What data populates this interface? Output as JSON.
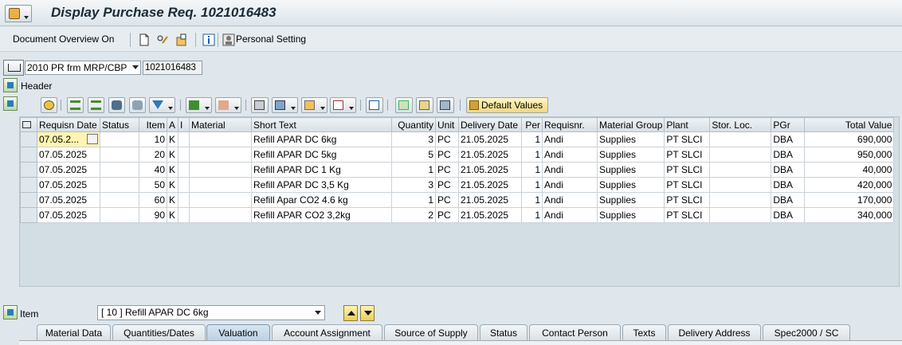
{
  "window": {
    "title": "Display Purchase Req. 1021016483"
  },
  "app_toolbar": {
    "doc_overview_label": "Document Overview On",
    "personal_setting_label": "Personal Setting"
  },
  "doc_header": {
    "doc_type": "2010 PR frm MRP/CBP",
    "doc_number": "1021016483",
    "header_label": "Header"
  },
  "grid_toolbar": {
    "default_values_label": "Default Values"
  },
  "table": {
    "columns": [
      "Requisn Date",
      "Status",
      "Item",
      "A",
      "I",
      "Material",
      "Short Text",
      "Quantity",
      "Unit",
      "Delivery Date",
      "Per",
      "Requisnr.",
      "Material Group",
      "Plant",
      "Stor. Loc.",
      "PGr",
      "Total Value"
    ],
    "rows": [
      [
        "07.05.2...",
        "",
        "10",
        "K",
        "",
        "",
        "Refill APAR DC 6kg",
        "3",
        "PC",
        "21.05.2025",
        "1",
        "Andi",
        "Supplies",
        "PT SLCI",
        "",
        "DBA",
        "690,000"
      ],
      [
        "07.05.2025",
        "",
        "20",
        "K",
        "",
        "",
        "Refill APAR DC 5kg",
        "5",
        "PC",
        "21.05.2025",
        "1",
        "Andi",
        "Supplies",
        "PT SLCI",
        "",
        "DBA",
        "950,000"
      ],
      [
        "07.05.2025",
        "",
        "40",
        "K",
        "",
        "",
        "Refill APAR DC 1 Kg",
        "1",
        "PC",
        "21.05.2025",
        "1",
        "Andi",
        "Supplies",
        "PT SLCI",
        "",
        "DBA",
        "40,000"
      ],
      [
        "07.05.2025",
        "",
        "50",
        "K",
        "",
        "",
        "Refill APAR DC 3,5 Kg",
        "3",
        "PC",
        "21.05.2025",
        "1",
        "Andi",
        "Supplies",
        "PT SLCI",
        "",
        "DBA",
        "420,000"
      ],
      [
        "07.05.2025",
        "",
        "60",
        "K",
        "",
        "",
        "Refill Apar CO2 4.6 kg",
        "1",
        "PC",
        "21.05.2025",
        "1",
        "Andi",
        "Supplies",
        "PT SLCI",
        "",
        "DBA",
        "170,000"
      ],
      [
        "07.05.2025",
        "",
        "90",
        "K",
        "",
        "",
        "Refill APAR CO2 3,2kg",
        "2",
        "PC",
        "21.05.2025",
        "1",
        "Andi",
        "Supplies",
        "PT SLCI",
        "",
        "DBA",
        "340,000"
      ]
    ]
  },
  "item": {
    "label": "Item",
    "selected": "[ 10 ] Refill APAR DC 6kg"
  },
  "tabs": [
    {
      "label": "Material Data"
    },
    {
      "label": "Quantities/Dates"
    },
    {
      "label": "Valuation"
    },
    {
      "label": "Account Assignment"
    },
    {
      "label": "Source of Supply"
    },
    {
      "label": "Status"
    },
    {
      "label": "Contact Person"
    },
    {
      "label": "Texts"
    },
    {
      "label": "Delivery Address"
    },
    {
      "label": "Spec2000 / SC"
    }
  ],
  "active_tab": "Valuation",
  "colors": {
    "accent": "#e9cf5c",
    "tab_active": "#b9cfe3",
    "background": "#dfe6ec"
  }
}
